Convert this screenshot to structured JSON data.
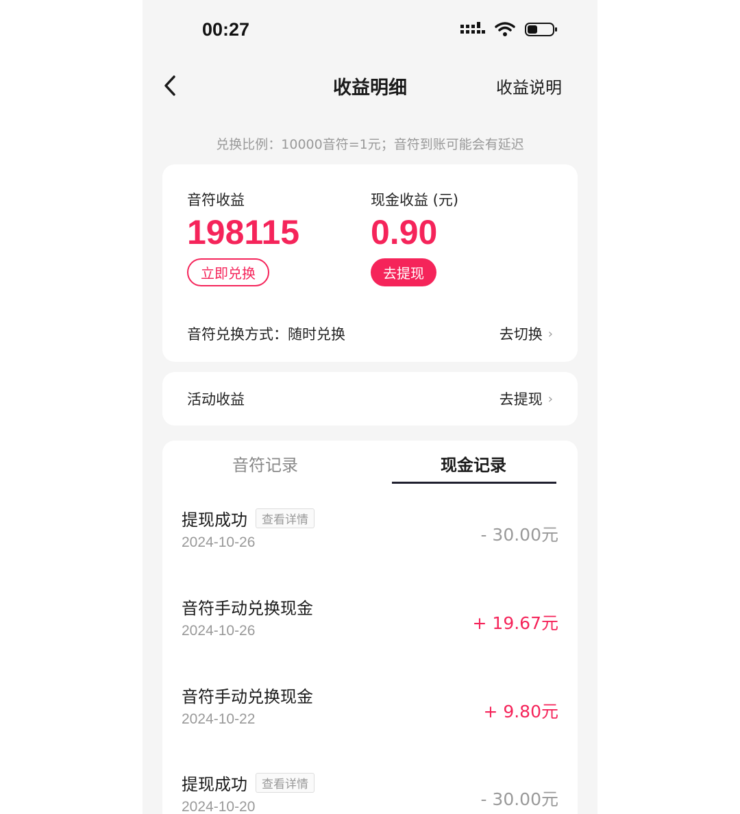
{
  "status": {
    "time": "00:27"
  },
  "nav": {
    "title": "收益明细",
    "right_link": "收益说明"
  },
  "rate_note": "兑换比例：10000音符=1元；音符到账可能会有延迟",
  "earnings": {
    "note_label": "音符收益",
    "note_value": "198115",
    "note_button": "立即兑换",
    "cash_label": "现金收益 (元)",
    "cash_value": "0.90",
    "cash_button": "去提现",
    "exchange_mode_label": "音符兑换方式：随时兑换",
    "exchange_mode_link": "去切换"
  },
  "activity": {
    "label": "活动收益",
    "link": "去提现"
  },
  "tabs": {
    "sound": "音符记录",
    "cash": "现金记录"
  },
  "records": [
    {
      "title": "提现成功",
      "tag": "查看详情",
      "date": "2024-10-26",
      "amount": "- 30.00元",
      "sign": "neg"
    },
    {
      "title": "音符手动兑换现金",
      "tag": "",
      "date": "2024-10-26",
      "amount": "+ 19.67元",
      "sign": "pos"
    },
    {
      "title": "音符手动兑换现金",
      "tag": "",
      "date": "2024-10-22",
      "amount": "+ 9.80元",
      "sign": "pos"
    },
    {
      "title": "提现成功",
      "tag": "查看详情",
      "date": "2024-10-20",
      "amount": "- 30.00元",
      "sign": "neg"
    }
  ],
  "colors": {
    "accent": "#f5245a",
    "muted": "#999999",
    "bg": "#f5f5f5"
  }
}
